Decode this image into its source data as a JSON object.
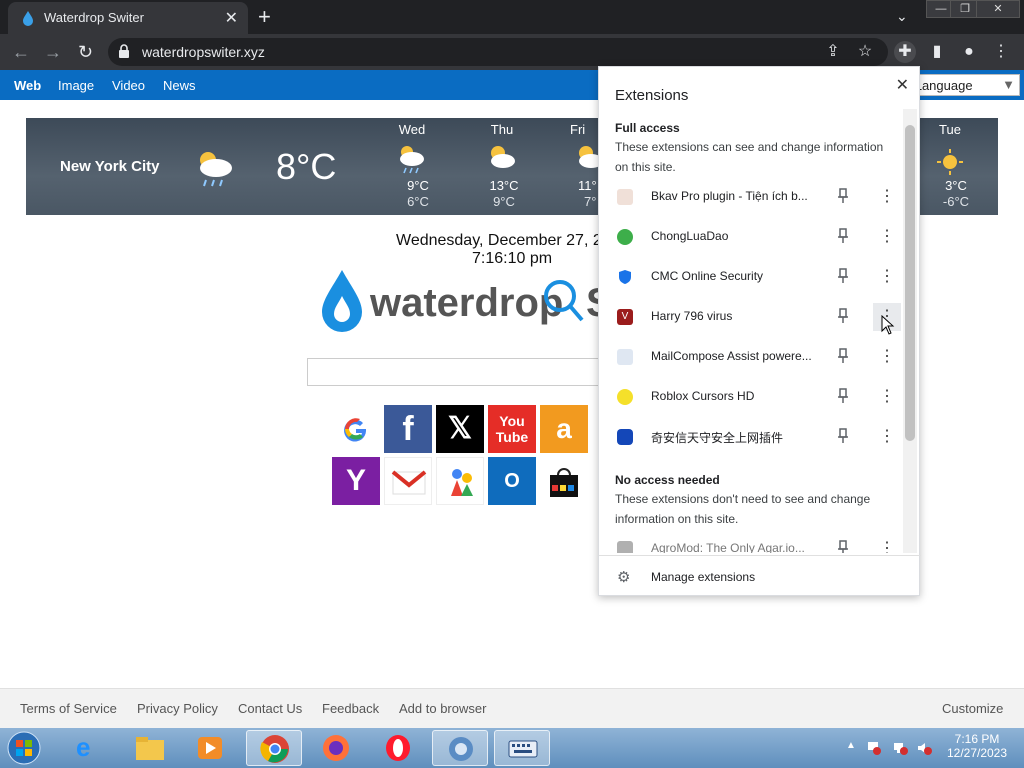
{
  "browser": {
    "tab_title": "Waterdrop Switer",
    "tab_close": "✕",
    "new_tab": "+",
    "url": "waterdropswiter.xyz"
  },
  "site_nav": {
    "items": [
      "Web",
      "Image",
      "Video",
      "News"
    ],
    "select_language": "ct Language"
  },
  "weather": {
    "city": "New York City",
    "current_temp": "8°C",
    "days": [
      {
        "day": "Wed",
        "hi": "9°C",
        "lo": "6°C"
      },
      {
        "day": "Thu",
        "hi": "13°C",
        "lo": "9°C"
      },
      {
        "day": "Fri",
        "hi": "11°",
        "lo": "7°"
      },
      {
        "day": "Tue",
        "hi": "3°C",
        "lo": "-6°C"
      }
    ]
  },
  "date": "Wednesday, December 27, 2",
  "time": "7:16:10 pm",
  "logo_text": "waterdrop",
  "extensions_popup": {
    "title": "Extensions",
    "full_access": {
      "heading": "Full access",
      "desc": "These extensions can see and change information on this site."
    },
    "full_access_items": [
      {
        "name": "Bkav Pro plugin - Tiện ích b...",
        "color": "#f0e0d8"
      },
      {
        "name": "ChongLuaDao",
        "color": "#3dae4a"
      },
      {
        "name": "CMC Online Security",
        "color": "#1a73e8"
      },
      {
        "name": "Harry 796 virus",
        "color": "#9b1c1c"
      },
      {
        "name": "MailCompose Assist powere...",
        "color": "#dfe7f2"
      },
      {
        "name": "Roblox Cursors HD",
        "color": "#f5e02a"
      },
      {
        "name": "奇安信天守安全上网插件",
        "color": "#1447b8"
      }
    ],
    "no_access": {
      "heading": "No access needed",
      "desc": "These extensions don't need to see and change information on this site."
    },
    "no_access_items": [
      {
        "name": "AgroMod: The Only Agar.io...",
        "color": "#b0b0b0"
      }
    ],
    "manage": "Manage extensions",
    "close": "✕"
  },
  "footer": {
    "links": [
      "Terms of Service",
      "Privacy Policy",
      "Contact Us",
      "Feedback",
      "Add to browser"
    ],
    "customize": "Customize"
  },
  "taskbar": {
    "time": "7:16 PM",
    "date": "12/27/2023"
  }
}
